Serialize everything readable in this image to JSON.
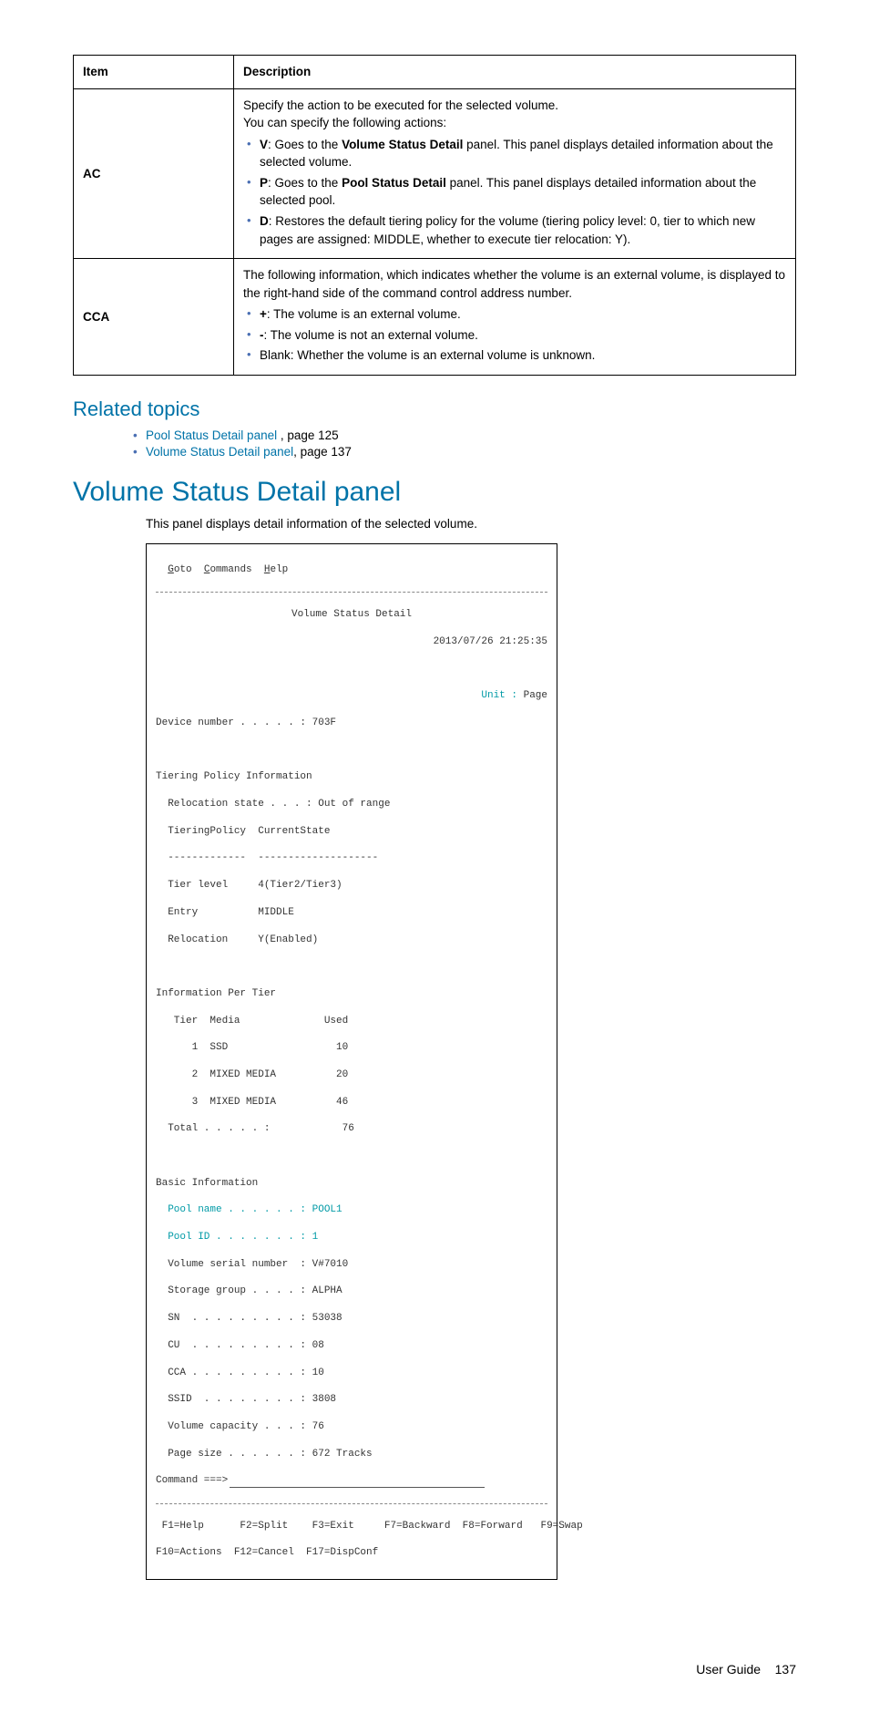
{
  "table": {
    "headers": {
      "c1": "Item",
      "c2": "Description"
    },
    "rows": [
      {
        "item": "AC",
        "intro1": "Specify the action to be executed for the selected volume.",
        "intro2": "You can specify the following actions:",
        "bullets": [
          {
            "b": "V",
            "t1": ": Goes to the ",
            "b2": "Volume Status Detail",
            "t2": " panel. This panel displays detailed information about the selected volume."
          },
          {
            "b": "P",
            "t1": ": Goes to the ",
            "b2": "Pool Status Detail",
            "t2": " panel. This panel displays detailed information about the selected pool."
          },
          {
            "b": "D",
            "t1": ": Restores the default tiering policy for the volume (tiering policy level: 0, tier to which new pages are assigned: MIDDLE, whether to execute tier relocation: Y).",
            "b2": "",
            "t2": ""
          }
        ]
      },
      {
        "item": "CCA",
        "intro1": "The following information, which indicates whether the volume is an external volume, is displayed to the right-hand side of the command control address number.",
        "intro2": "",
        "bullets": [
          {
            "b": "+",
            "t1": ": The volume is an external volume.",
            "b2": "",
            "t2": ""
          },
          {
            "b": "-",
            "t1": ": The volume is not an external volume.",
            "b2": "",
            "t2": ""
          },
          {
            "b": "",
            "t1": "Blank: Whether the volume is an external volume is unknown.",
            "b2": "",
            "t2": ""
          }
        ]
      }
    ]
  },
  "related": {
    "heading": "Related topics",
    "items": [
      {
        "link": "Pool Status Detail panel ",
        "suffix": ", page 125"
      },
      {
        "link": "Volume Status Detail panel",
        "suffix": ", page 137"
      }
    ]
  },
  "section": {
    "title": "Volume Status Detail panel",
    "intro": "This panel displays detail information of the selected volume."
  },
  "terminal": {
    "menu": {
      "g": "G",
      "goto": "oto  ",
      "c": "C",
      "cmds": "ommands  ",
      "h": "H",
      "help": "elp"
    },
    "title": "Volume Status Detail",
    "timestamp": "2013/07/26 21:25:35",
    "unit": "Unit : ",
    "unit_val": "Page",
    "device": "Device number . . . . . : 703F",
    "tpi_h": "Tiering Policy Information",
    "tpi1": "  Relocation state . . . : Out of range",
    "tpi2": "  TieringPolicy  CurrentState",
    "tpi3": "  -------------  --------------------",
    "tpi4": "  Tier level     4(Tier2/Tier3)",
    "tpi5": "  Entry          MIDDLE",
    "tpi6": "  Relocation     Y(Enabled)",
    "ipt_h": "Information Per Tier",
    "ipt1": "   Tier  Media              Used",
    "ipt2": "      1  SSD                  10",
    "ipt3": "      2  MIXED MEDIA          20",
    "ipt4": "      3  MIXED MEDIA          46",
    "ipt5": "  Total . . . . . :            76",
    "bi_h": "Basic Information",
    "bi1": "Pool name . . . . . . : POOL1",
    "bi2": "Pool ID . . . . . . . : 1",
    "bi3": "  Volume serial number  : V#7010",
    "bi4": "  Storage group . . . . : ALPHA",
    "bi5": "  SN  . . . . . . . . . : 53038",
    "bi6": "  CU  . . . . . . . . . : 08",
    "bi7": "  CCA . . . . . . . . . : 10",
    "bi8": "  SSID  . . . . . . . . : 3808",
    "bi9": "  Volume capacity . . . : 76",
    "bi10": "  Page size . . . . . . : 672 Tracks",
    "cmd": "Command ===>",
    "fk1": " F1=Help      F2=Split    F3=Exit     F7=Backward  F8=Forward   F9=Swap",
    "fk2": "F10=Actions  F12=Cancel  F17=DispConf"
  },
  "footer": {
    "label": "User Guide",
    "page": "137"
  }
}
